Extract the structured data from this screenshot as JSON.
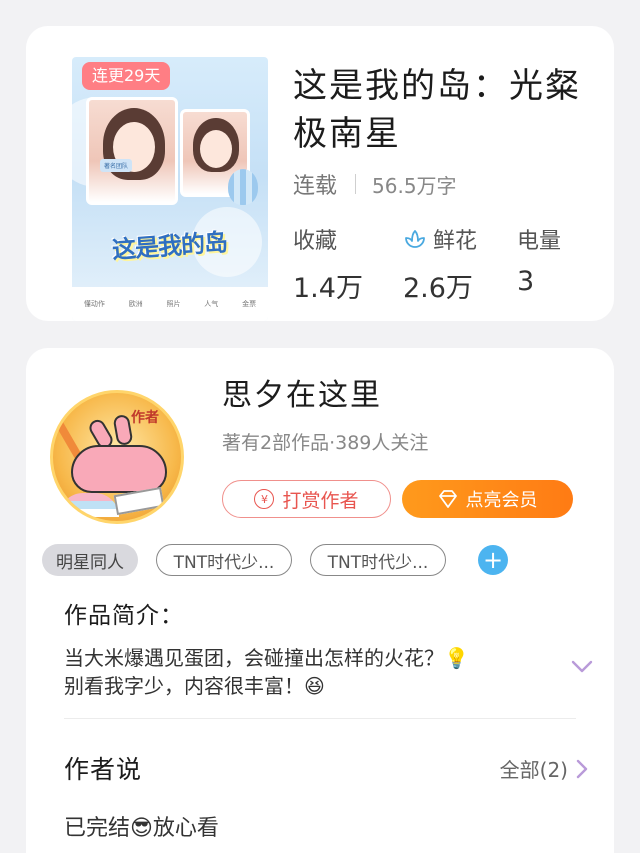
{
  "book": {
    "badge": "连更29天",
    "title": "这是我的岛：光粲极南星",
    "status": "连载",
    "word_count": "56.5万字",
    "stats": [
      {
        "label": "收藏",
        "value": "1.4万",
        "icon": null
      },
      {
        "label": "鲜花",
        "value": "2.6万",
        "icon": "flower-icon"
      },
      {
        "label": "电量",
        "value": "3",
        "icon": null
      }
    ],
    "cover": {
      "title_art": "这是我的岛",
      "bottom_items": [
        "懂动作",
        "欧洲",
        "照片",
        "人气",
        "金票"
      ],
      "tag": "著名团队"
    }
  },
  "author": {
    "name": "思夕在这里",
    "info": "著有2部作品·389人关注",
    "avatar_text": "作者",
    "tip_button": "打赏作者",
    "vip_button": "点亮会员",
    "tags": [
      "明星同人",
      "TNT时代少...",
      "TNT时代少..."
    ]
  },
  "intro": {
    "title": "作品简介：",
    "line1": "当大米爆遇见蛋团，会碰撞出怎样的火花？💡",
    "line2": "别看我字少，内容很丰富！😆"
  },
  "author_says": {
    "title": "作者说",
    "all_label": "全部(2)",
    "note": "已完结😎放心看"
  },
  "colors": {
    "badge": "#ff7e84",
    "tip": "#e8554f",
    "vip": "#ff8a18",
    "add": "#4cb4f0",
    "expand": "#b99ad9"
  }
}
